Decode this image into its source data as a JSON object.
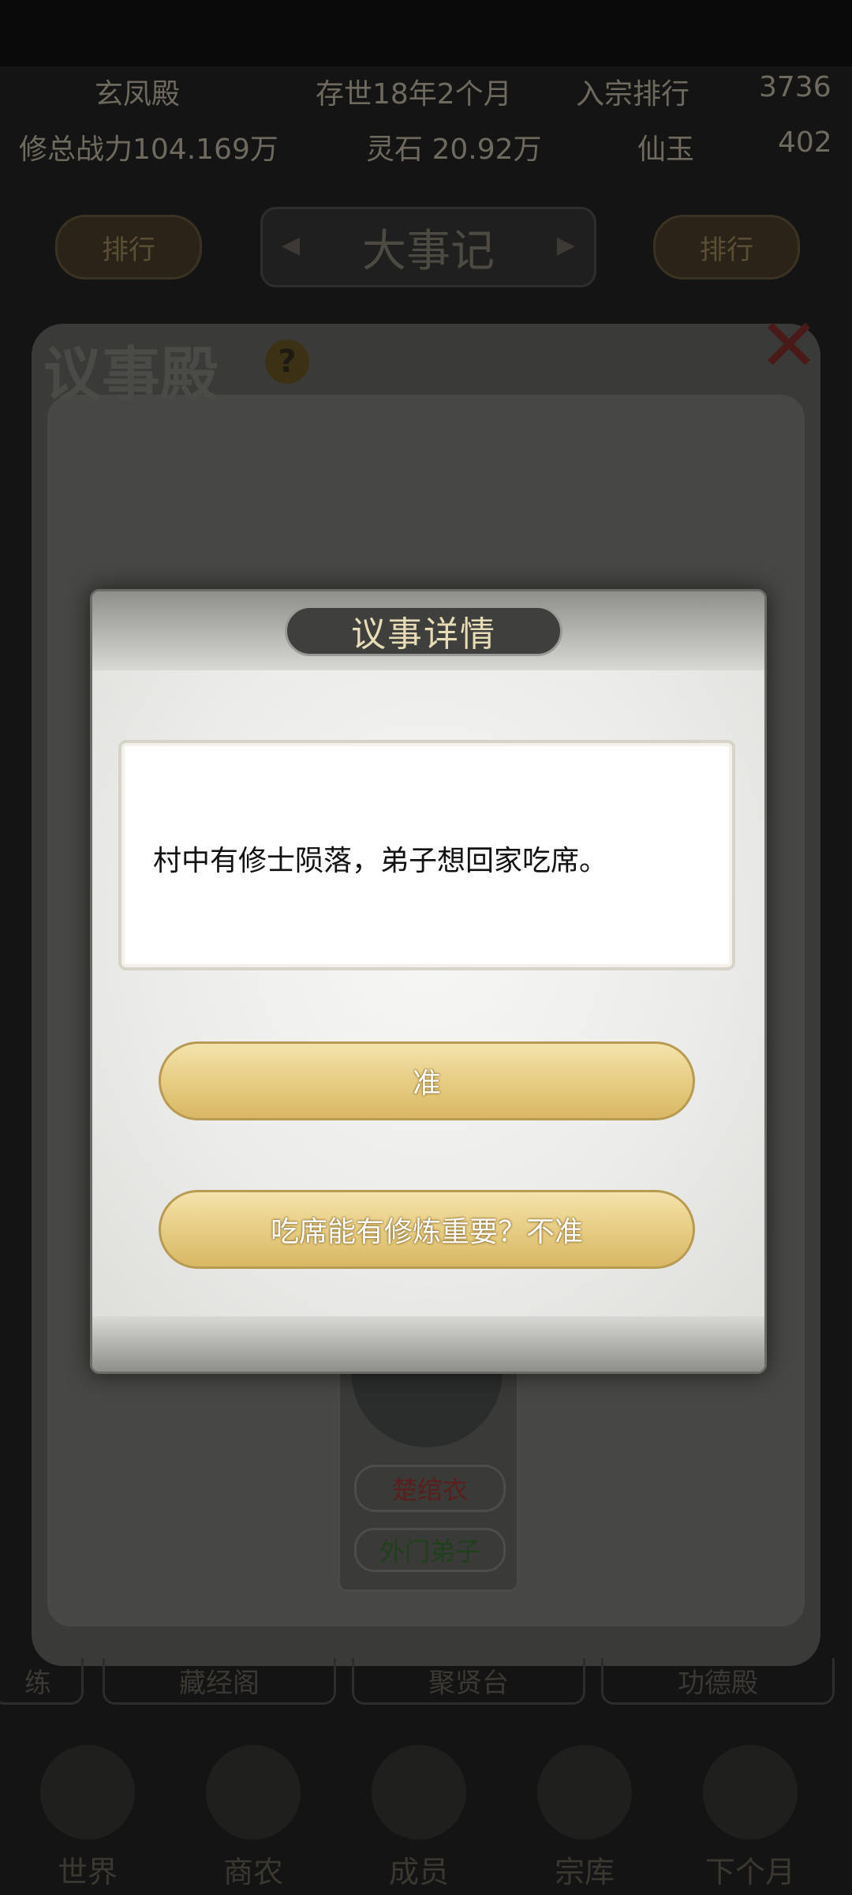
{
  "header": {
    "sect_name": "玄凤殿",
    "age": "存世18年2个月",
    "ranking_label": "入宗排行",
    "ranking_value": "3736",
    "combat_power": "修总战力104.169万",
    "spirit_stone": "灵石 20.92万",
    "fairy_jade_label": "仙玉",
    "fairy_jade_value": "402"
  },
  "nav": {
    "left_label": "排行",
    "title": "大事记",
    "right_label": "排行",
    "prev_arrow": "◀",
    "next_arrow": "▶"
  },
  "hall": {
    "title": "议事殿",
    "help_glyph": "?",
    "close_glyph": "✕",
    "disciple_name": "楚绾衣",
    "disciple_rank": "外门弟子"
  },
  "bottom_tabs": [
    "练",
    "藏经阁",
    "聚贤台",
    "功德殿"
  ],
  "dock": [
    "世界",
    "商农",
    "成员",
    "宗库",
    "下个月"
  ],
  "dialog": {
    "title": "议事详情",
    "message": "村中有修士陨落，弟子想回家吃席。",
    "approve_label": "准",
    "deny_label": "吃席能有修炼重要？不准"
  },
  "colors": {
    "button_gold": "#e7cd83",
    "title_bg": "#3f3f3d",
    "title_text": "#e6dcb5"
  }
}
